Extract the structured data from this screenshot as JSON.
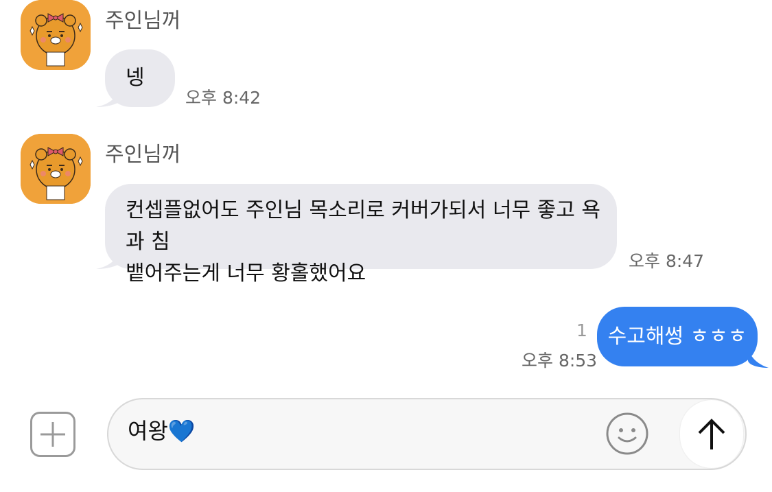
{
  "messages": [
    {
      "sender": "주인님꺼",
      "text": "넹",
      "time": "오후 8:42"
    },
    {
      "sender": "주인님꺼",
      "line1": "컨셉플없어도 주인님 목소리로 커버가되서 너무 좋고 욕과 침",
      "line2": "뱉어주는게 너무 황홀했어요",
      "time": "오후 8:47"
    }
  ],
  "outgoing": {
    "text": "수고해썽 ㅎㅎㅎ",
    "time": "오후 8:53",
    "unread": "1"
  },
  "composer": {
    "value": "여왕💙"
  },
  "icons": {
    "avatar": "ryan-character-avatar",
    "add": "plus-icon",
    "emoji": "smiley-icon",
    "send": "arrow-up-icon"
  },
  "colors": {
    "outgoing_bubble": "#3481f0",
    "incoming_bubble": "#e9e9ee",
    "avatar_bg": "#f0a23a"
  }
}
